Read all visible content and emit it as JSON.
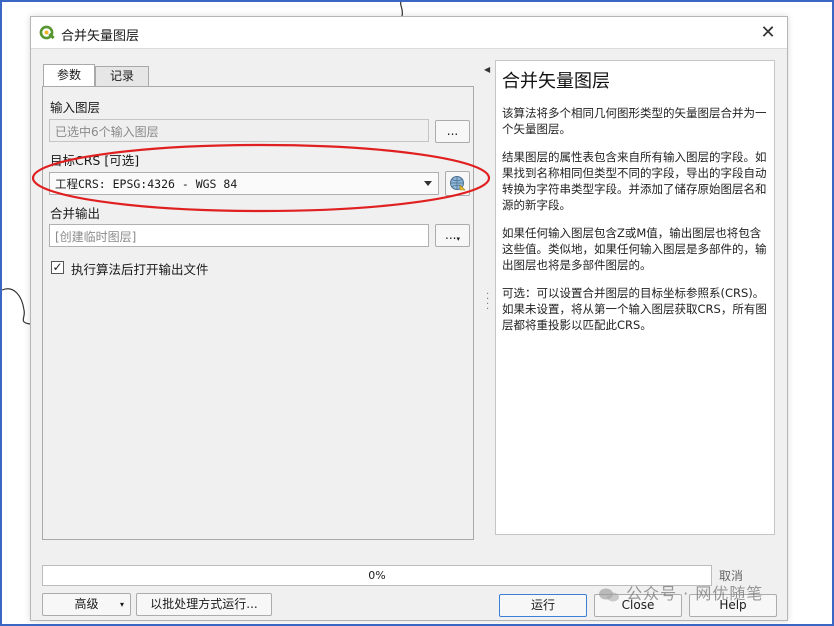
{
  "dialog": {
    "title": "合并矢量图层"
  },
  "tabs": [
    {
      "label": "参数"
    },
    {
      "label": "记录"
    }
  ],
  "params": {
    "input_layers": {
      "label": "输入图层",
      "value": "已选中6个输入图层",
      "button": "..."
    },
    "target_crs": {
      "label": "目标CRS [可选]",
      "value": "工程CRS: EPSG:4326 - WGS 84"
    },
    "merge_output": {
      "label": "合并输出",
      "placeholder": "[创建临时图层]",
      "button": "..."
    },
    "open_after": {
      "label": "执行算法后打开输出文件",
      "checked": true,
      "check": "✓"
    }
  },
  "help": {
    "title": "合并矢量图层",
    "paragraphs": [
      "该算法将多个相同几何图形类型的矢量图层合并为一个矢量图层。",
      "结果图层的属性表包含来自所有输入图层的字段。如果找到名称相同但类型不同的字段，导出的字段自动转换为字符串类型字段。并添加了储存原始图层名和源的新字段。",
      "如果任何输入图层包含Z或M值，输出图层也将包含这些值。类似地，如果任何输入图层是多部件的，输出图层也将是多部件图层的。",
      "可选：可以设置合并图层的目标坐标参照系(CRS)。如果未设置，将从第一个输入图层获取CRS，所有图层都将重投影以匹配此CRS。"
    ]
  },
  "progress": {
    "value": 0.0,
    "label": "0%"
  },
  "buttons": {
    "advanced": "高级",
    "batch": "以批处理方式运行...",
    "cancel": "取消",
    "run": "运行",
    "close": "Close",
    "help": "Help"
  },
  "watermark": {
    "text": "公众号 · 网优随笔"
  },
  "colors": {
    "annotation_ellipse": "#e02020",
    "frame_border": "#3a66c4",
    "qgis_green": "#589632"
  }
}
